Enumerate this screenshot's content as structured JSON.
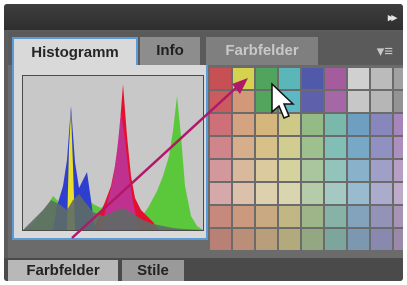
{
  "panel": {
    "tabs": [
      {
        "label": "Histogramm",
        "active": true
      },
      {
        "label": "Info",
        "active": false
      },
      {
        "label": "Farbfelder",
        "active": false
      }
    ],
    "collapse_icon": "double-chevron-right-icon",
    "menu_icon": "panel-menu-icon"
  },
  "bottom_tabs": [
    {
      "label": "Farbfelder"
    },
    {
      "label": "Stile"
    }
  ],
  "colors": {
    "accent": "#5a9bd5",
    "arrow": "#b0186a",
    "histogram_bg": "#c8c8c8",
    "histogram_red": "#e5102f",
    "histogram_green": "#5ac83a",
    "histogram_blue": "#2e3fd0",
    "histogram_magenta": "#c0308e",
    "histogram_gray": "#5e6b66",
    "histogram_yellow": "#e8e02a"
  },
  "swatches": [
    "#d84c52",
    "#e8e44a",
    "#4cae5c",
    "#59c3c8",
    "#4d58b6",
    "#b05aa6",
    "#e2e2e2",
    "#c9c9c9",
    "#ababab",
    "#db5a5e",
    "#e6a07a",
    "#4fae5a",
    "#5ac6d4",
    "#5d5fb8",
    "#b167b1",
    "#d7d7d7",
    "#c3c3c3",
    "#9a9a9a",
    "#e0717a",
    "#e7ae86",
    "#e8c37f",
    "#e0da8b",
    "#9cc98a",
    "#7cc7b8",
    "#6fa8d0",
    "#8c8ccc",
    "#b08ac8",
    "#e18a90",
    "#e9ba92",
    "#ecd18f",
    "#e3df97",
    "#a6cf95",
    "#86cdc2",
    "#7ab3d6",
    "#9797d2",
    "#b896cd",
    "#e5a1a5",
    "#ecc7a4",
    "#efdba7",
    "#e8e5aa",
    "#b6d7a7",
    "#9ad4ca",
    "#8fbfdb",
    "#a9a9d8",
    "#c4a7d4",
    "#e8b3b6",
    "#efd0b4",
    "#f1e2b8",
    "#ebe8bb",
    "#c3ddb7",
    "#aedad2",
    "#a2c9e0",
    "#b7b7dd",
    "#cdb6da",
    "#d88f80",
    "#dba282",
    "#d9b485",
    "#d1c58a",
    "#a8c290",
    "#8cbfb1",
    "#87adc9",
    "#9a9ac6",
    "#b29ac2",
    "#c78578",
    "#c9967a",
    "#c6a77d",
    "#bfb681",
    "#9ab287",
    "#80b0a4",
    "#7ea1bd",
    "#8f8fbb",
    "#a48fb6"
  ]
}
